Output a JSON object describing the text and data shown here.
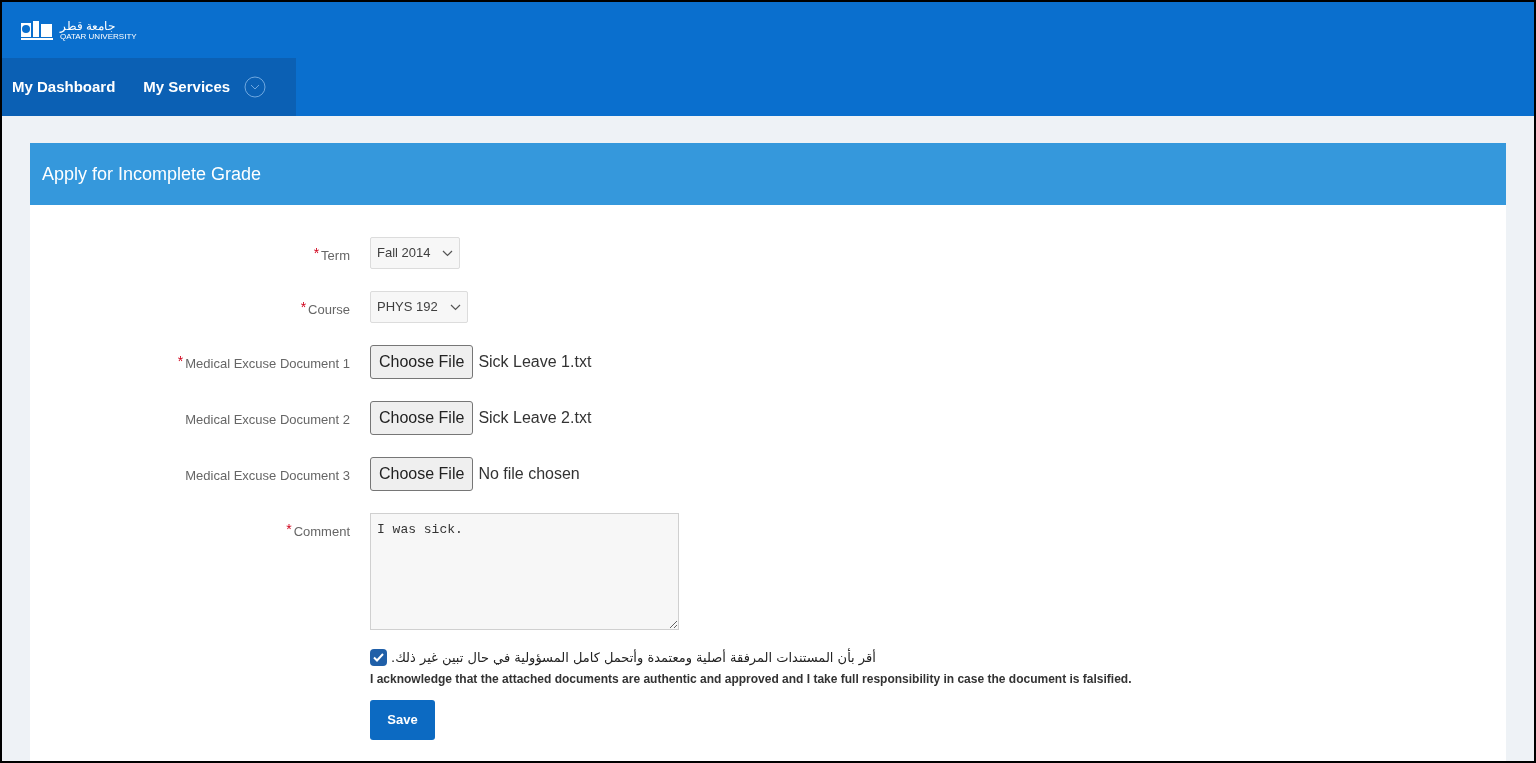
{
  "logo": {
    "arabic": "جامعة قطر",
    "english": "QATAR UNIVERSITY"
  },
  "nav": [
    {
      "label": "My Dashboard"
    },
    {
      "label": "My Services"
    }
  ],
  "panel": {
    "title": "Apply for Incomplete Grade"
  },
  "required_marker": "*",
  "fields": [
    {
      "kind": "select",
      "label": "Term",
      "required": true,
      "value": "Fall 2014"
    },
    {
      "kind": "select",
      "label": "Course",
      "required": true,
      "value": "PHYS 192"
    },
    {
      "kind": "file",
      "label": "Medical Excuse Document 1",
      "required": true,
      "button": "Choose File",
      "value": "Sick Leave 1.txt"
    },
    {
      "kind": "file",
      "label": "Medical Excuse Document 2",
      "required": false,
      "button": "Choose File",
      "value": "Sick Leave 2.txt"
    },
    {
      "kind": "file",
      "label": "Medical Excuse Document 3",
      "required": false,
      "button": "Choose File",
      "value": "No file chosen"
    },
    {
      "kind": "textarea",
      "label": "Comment",
      "required": true,
      "value": "I was sick."
    }
  ],
  "acknowledge": {
    "checked": true,
    "arabic": "أقر بأن المستندات المرفقة أصلية ومعتمدة وأتحمل كامل المسؤولية في حال تبين غير ذلك.",
    "english": "I acknowledge that the attached documents are authentic and approved and I take full responsibility in case the document is falsified."
  },
  "save": "Save"
}
